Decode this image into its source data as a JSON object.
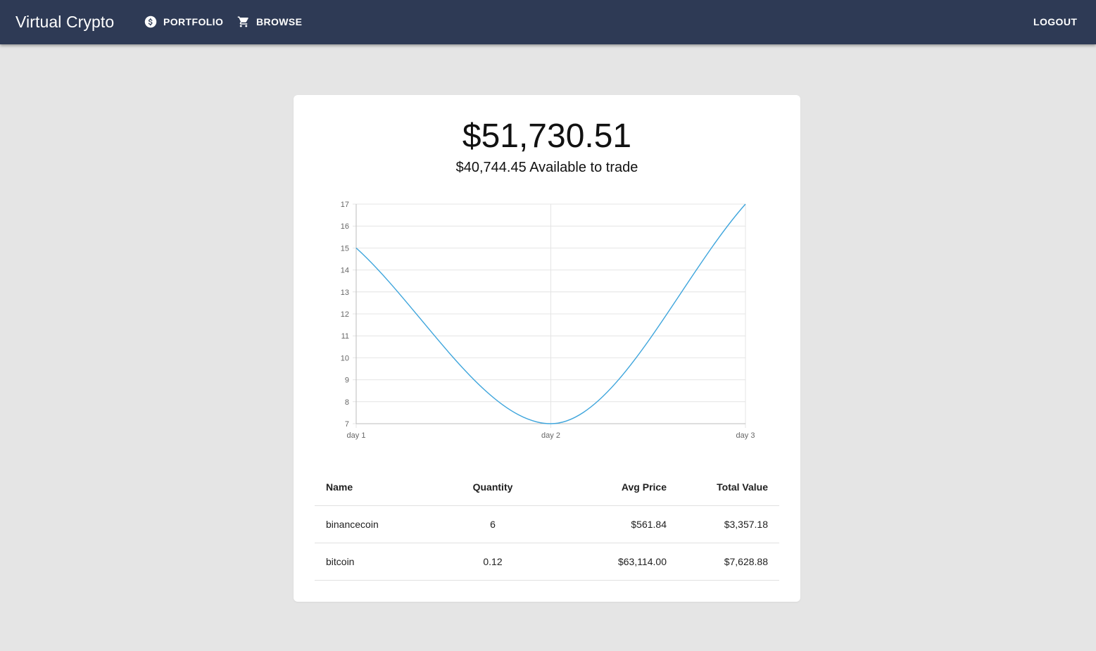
{
  "app": {
    "title": "Virtual Crypto"
  },
  "nav": {
    "portfolio": {
      "label": "PORTFOLIO",
      "icon": "dollar-circle-icon"
    },
    "browse": {
      "label": "BROWSE",
      "icon": "cart-icon"
    },
    "logout": {
      "label": "LOGOUT"
    }
  },
  "colors": {
    "appbar": "#2e3a55",
    "background": "#e5e5e5",
    "line": "#3ea5dc"
  },
  "summary": {
    "total_value": "$51,730.51",
    "available_amount": "$40,744.45",
    "available_label": "Available to trade"
  },
  "chart_data": {
    "type": "line",
    "categories": [
      "day 1",
      "day 2",
      "day 3"
    ],
    "series": [
      {
        "values": [
          15,
          7,
          17
        ]
      }
    ],
    "ylim": [
      7,
      17
    ],
    "yticks": [
      7,
      8,
      9,
      10,
      11,
      12,
      13,
      14,
      15,
      16,
      17
    ],
    "grid": true,
    "smooth": true,
    "title": "",
    "xlabel": "",
    "ylabel": ""
  },
  "holdings": {
    "headers": {
      "name": "Name",
      "quantity": "Quantity",
      "avg_price": "Avg Price",
      "total_value": "Total Value"
    },
    "rows": [
      {
        "name": "binancecoin",
        "quantity": "6",
        "avg_price": "$561.84",
        "total_value": "$3,357.18"
      },
      {
        "name": "bitcoin",
        "quantity": "0.12",
        "avg_price": "$63,114.00",
        "total_value": "$7,628.88"
      }
    ]
  }
}
